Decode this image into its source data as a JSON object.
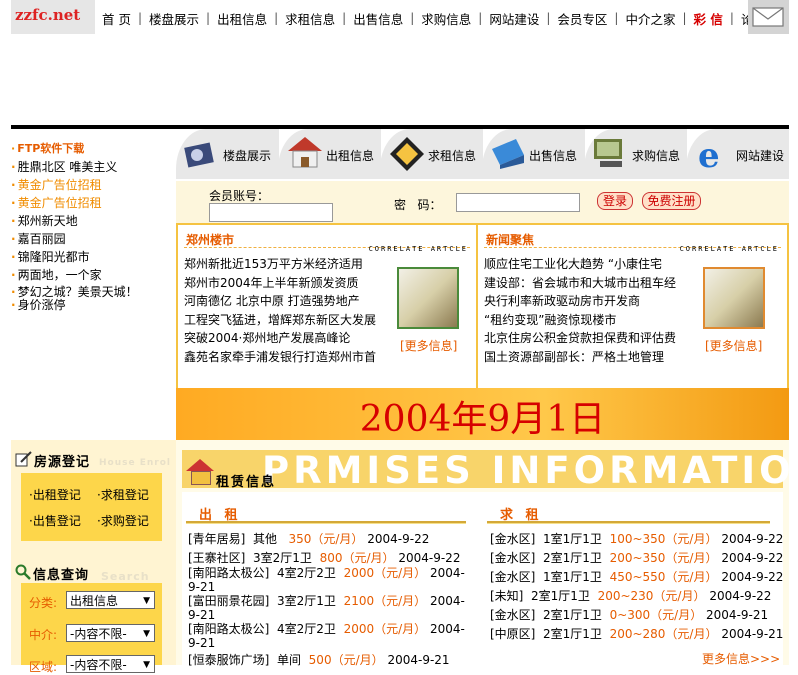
{
  "logo": {
    "text": "zzfc.net"
  },
  "top_nav": [
    {
      "label": "首 页"
    },
    {
      "label": "楼盘展示"
    },
    {
      "label": "出租信息"
    },
    {
      "label": "求租信息"
    },
    {
      "label": "出售信息"
    },
    {
      "label": "求购信息"
    },
    {
      "label": "网站建设"
    },
    {
      "label": "会员专区"
    },
    {
      "label": "中介之家"
    },
    {
      "label": "彩 信"
    },
    {
      "label": "论坛"
    }
  ],
  "left_links": [
    {
      "label": "FTP软件下载",
      "style": "orange-bold"
    },
    {
      "label": "胜鼎北区 唯美主义"
    },
    {
      "label": "黄金广告位招租",
      "style": "orange"
    },
    {
      "label": "黄金广告位招租",
      "style": "orange"
    },
    {
      "label": "郑州新天地"
    },
    {
      "label": "嘉百丽园"
    },
    {
      "label": "锦隆阳光都市"
    },
    {
      "label": "两面地，一个家"
    },
    {
      "label": "梦幻之城？美景天城！"
    },
    {
      "label": "身价涨停"
    }
  ],
  "category_tabs": [
    {
      "label": "楼盘展示",
      "icon": "film-camera-icon"
    },
    {
      "label": "出租信息",
      "icon": "house-icon"
    },
    {
      "label": "求租信息",
      "icon": "road-sign-icon"
    },
    {
      "label": "出售信息",
      "icon": "blue-house-icon"
    },
    {
      "label": "求购信息",
      "icon": "computer-icon"
    },
    {
      "label": "网站建设",
      "icon": "internet-explorer-icon"
    }
  ],
  "login": {
    "account_label": "会员账号：",
    "password_label": "密   码：",
    "login_button": "登录",
    "register_button": "免费注册"
  },
  "news_panels": [
    {
      "title": "郑州楼市",
      "tag": "CORRELATE ARTCLE",
      "items": [
        "郑州新批近153万平方米经济适用",
        "郑州市2004年上半年新颁发资质",
        "河南德亿 北京中原 打造强势地产",
        "工程突飞猛进，增辉郑东新区大发展",
        "突破2004·郑州地产发展高峰论",
        "鑫苑名家牵手浦发银行打造郑州市首"
      ],
      "more": "[更多信息]"
    },
    {
      "title": "新闻聚焦",
      "tag": "CORRELATE ARTCLE",
      "items": [
        "顺应住宅工业化大趋势 “小康住宅",
        "建设部：省会城市和大城市出租车经",
        "央行利率新政驱动房市开发商",
        "“租约变现”融资惊现楼市",
        "北京住房公积金贷款担保费和评估费",
        "国土资源部副部长：严格土地管理"
      ],
      "more": "[更多信息]"
    }
  ],
  "date_banner": "2004年9月1日",
  "house_register": {
    "title": "房源登记",
    "watermark": "House Enrol",
    "links": [
      "出租登记",
      "求租登记",
      "出售登记",
      "求购登记"
    ]
  },
  "info_query": {
    "title": "信息查询",
    "watermark": "Search",
    "fields": [
      {
        "label": "分类:",
        "value": "出租信息"
      },
      {
        "label": "中介:",
        "value": "-内容不限-"
      },
      {
        "label": "区域:",
        "value": "-内容不限-"
      }
    ]
  },
  "rental": {
    "title": "租赁信息",
    "watermark": "PRMISES INFORMATION",
    "rent_out": {
      "heading": "出 租",
      "rows": [
        {
          "name": "[青年居易]",
          "type": "其他",
          "price": "350（元/月）",
          "date": "2004-9-22"
        },
        {
          "name": "[王寨社区]",
          "type": "3室2厅1卫",
          "price": "800（元/月）",
          "date": "2004-9-22"
        },
        {
          "name": "[南阳路太极公]",
          "type": "4室2厅2卫",
          "price": "2000（元/月）",
          "date": "2004-9-21"
        },
        {
          "name": "[富田丽景花园]",
          "type": "3室2厅1卫",
          "price": "2100（元/月）",
          "date": "2004-9-21"
        },
        {
          "name": "[南阳路太极公]",
          "type": "4室2厅2卫",
          "price": "2000（元/月）",
          "date": "2004-9-21"
        },
        {
          "name": "[恒泰服饰广场]",
          "type": "单间",
          "price": "500（元/月）",
          "date": "2004-9-21"
        }
      ]
    },
    "want_rent": {
      "heading": "求 租",
      "rows": [
        {
          "name": "[金水区]",
          "type": "1室1厅1卫",
          "price": "100~350（元/月）",
          "date": "2004-9-22"
        },
        {
          "name": "[金水区]",
          "type": "2室1厅1卫",
          "price": "200~350（元/月）",
          "date": "2004-9-22"
        },
        {
          "name": "[金水区]",
          "type": "1室1厅1卫",
          "price": "450~550（元/月）",
          "date": "2004-9-22"
        },
        {
          "name": "[未知]",
          "type": "2室1厅1卫",
          "price": "200~230（元/月）",
          "date": "2004-9-22"
        },
        {
          "name": "[金水区]",
          "type": "2室1厅1卫",
          "price": "0~300（元/月）",
          "date": "2004-9-21"
        },
        {
          "name": "[中原区]",
          "type": "2室1厅1卫",
          "price": "200~280（元/月）",
          "date": "2004-9-21"
        }
      ],
      "more": "更多信息>>>"
    }
  }
}
